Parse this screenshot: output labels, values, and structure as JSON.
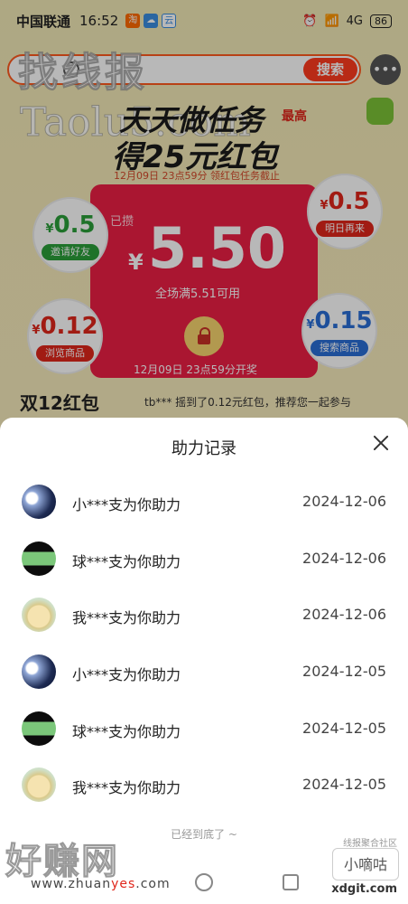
{
  "status_bar": {
    "carrier": "中国联通",
    "time": "16:52",
    "app_icons": [
      "taobao-icon",
      "weather-icon",
      "ai-icon"
    ],
    "network": "4G",
    "battery": "86"
  },
  "watermarks": {
    "top_left": "找线报",
    "top_left_url": "Taolu5.com",
    "bottom_left": "好赚网",
    "bottom_url_pre": "www.zhuan",
    "bottom_url_hl": "yes",
    "bottom_url_post": ".com",
    "bottom_right_top": "线报聚合社区",
    "bottom_right": "小嘀咕",
    "bottom_right_url": "xdgit.com"
  },
  "background": {
    "search_button": "搜索",
    "hero_title_1": "天天做任务",
    "hero_title_2": "得25元红包",
    "hero_top_tag": "最高",
    "hero_sub": "12月09日 23点59分 领红包任务截止",
    "card": {
      "tag": "已攒",
      "currency": "¥",
      "amount": "5.50",
      "condition": "全场满5.51可用",
      "open_time": "12月09日 23点59分开奖"
    },
    "bubbles": [
      {
        "value": "0.5",
        "label": "邀请好友"
      },
      {
        "value": "0.5",
        "label": "明日再来"
      },
      {
        "value": "0.12",
        "label": "浏览商品"
      },
      {
        "value": "0.15",
        "label": "搜索商品"
      }
    ],
    "section_title": "双12红包",
    "ticker": "tb*** 摇到了0.12元红包，推荐您一起参与"
  },
  "sheet": {
    "title": "助力记录",
    "records": [
      {
        "text": "小***支为你助力",
        "date": "2024-12-06",
        "avatar": "night-sky-avatar"
      },
      {
        "text": "球***支为你助力",
        "date": "2024-12-06",
        "avatar": "grass-avatar"
      },
      {
        "text": "我***支为你助力",
        "date": "2024-12-06",
        "avatar": "cartoon-avatar"
      },
      {
        "text": "小***支为你助力",
        "date": "2024-12-05",
        "avatar": "night-sky-avatar"
      },
      {
        "text": "球***支为你助力",
        "date": "2024-12-05",
        "avatar": "grass-avatar"
      },
      {
        "text": "我***支为你助力",
        "date": "2024-12-05",
        "avatar": "cartoon-avatar"
      }
    ],
    "end_note": "已经到底了 ~"
  }
}
